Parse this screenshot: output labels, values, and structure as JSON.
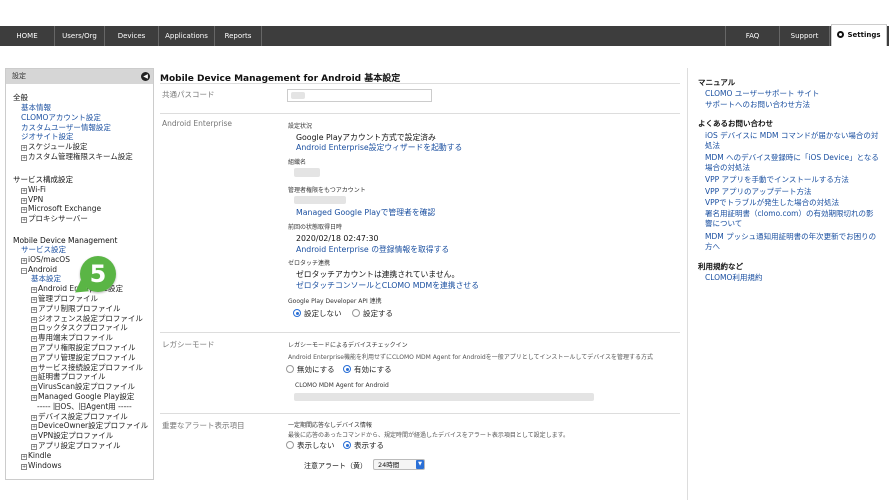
{
  "nav": {
    "tabs": [
      "HOME",
      "Users/Org",
      "Devices",
      "Applications",
      "Reports"
    ],
    "right_tabs": [
      "FAQ",
      "Support"
    ],
    "settings": "Settings"
  },
  "sidebar": {
    "header": "設定",
    "general_title": "全般",
    "general_links": [
      "基本情報",
      "CLOMOアカウント設定",
      "カスタムユーザー情報設定",
      "ジオサイト設定"
    ],
    "general_items": [
      "スケジュール設定",
      "カスタム管理権限スキーム設定"
    ],
    "service_title": "サービス構成設定",
    "service_items": [
      "Wi-Fi",
      "VPN",
      "Microsoft Exchange",
      "プロキシサーバー"
    ],
    "mdm_title": "Mobile Device Management",
    "mdm_link": "サービス設定",
    "ios": "iOS/macOS",
    "android": "Android",
    "android_basic": "基本設定",
    "android_items": [
      "Android Enterprise設定",
      "管理プロファイル",
      "アプリ制限プロファイル",
      "ジオフェンス設定プロファイル",
      "ロックタスクプロファイル",
      "専用端末プロファイル",
      "アプリ権限設定プロファイル",
      "アプリ管理設定プロファイル",
      "サービス接続設定プロファイル",
      "証明書プロファイル",
      "VirusScan設定プロファイル",
      "Managed Google Play設定"
    ],
    "separator": "----- 旧OS、旧Agent用 -----",
    "legacy_items": [
      "デバイス設定プロファイル",
      "DeviceOwner設定プロファイル",
      "VPN設定プロファイル",
      "アプリ設定プロファイル"
    ],
    "kindle": "Kindle",
    "windows": "Windows"
  },
  "badge": "5",
  "main": {
    "title": "Mobile Device Management for Android 基本設定",
    "passcode_label": "共通パスコード",
    "ae_label": "Android Enterprise",
    "setting_status_label": "設定状況",
    "gp_status": "Google Playアカウント方式で設定済み",
    "ae_wizard_link": "Android Enterprise設定ウィザードを起動する",
    "org_name_label": "組織名",
    "admin_account_label": "管理者権限をもつアカウント",
    "mgp_admin_link": "Managed Google Playで管理者を確認",
    "last_fetch_label": "前回の状態取得日時",
    "last_fetch_value": "2020/02/18 02:47:30",
    "fetch_link": "Android Enterprise の登録情報を取得する",
    "zt_label": "ゼロタッチ連携",
    "zt_status": "ゼロタッチアカウントは連携されていません。",
    "zt_link": "ゼロタッチコンソールとCLOMO MDMを連携させる",
    "gpdev_label": "Google Play Developer API 連携",
    "gpdev_off": "設定しない",
    "gpdev_on": "設定する",
    "legacy_label": "レガシーモード",
    "legacy_title": "レガシーモードによるデバイスチェックイン",
    "legacy_desc": "Android Enterprise機能を利用せずにCLOMO MDM Agent for Androidを一般アプリとしてインストールしてデバイスを管理する方式",
    "legacy_off": "無効にする",
    "legacy_on": "有効にする",
    "agent_label": "CLOMO MDM Agent for Android",
    "alert_label": "重要なアラート表示項目",
    "alert_title": "一定期間応答なしデバイス情報",
    "alert_desc": "最後に応答のあったコマンドから、規定時間が経過したデバイスをアラート表示項目として設定します。",
    "alert_off": "表示しない",
    "alert_on": "表示する",
    "caution_label": "注意アラート（黄）",
    "caution_value": "24時間"
  },
  "right": {
    "manual_title": "マニュアル",
    "manual_links": [
      "CLOMO ユーザーサポート サイト",
      "サポートへのお問い合わせ方法"
    ],
    "faq_title": "よくあるお問い合わせ",
    "faq_links": [
      "iOS デバイスに MDM コマンドが届かない場合の対処法",
      "MDM へのデバイス登録時に「iOS Device」となる場合の対処法",
      "VPP アプリを手動でインストールする方法",
      "VPP アプリのアップデート方法",
      "VPPでトラブルが発生した場合の対処法",
      "署名用証明書（clomo.com）の有効期限切れの影響について",
      "MDM プッシュ通知用証明書の年次更新でお困りの方へ"
    ],
    "terms_title": "利用規約など",
    "terms_links": [
      "CLOMO利用規約"
    ]
  }
}
